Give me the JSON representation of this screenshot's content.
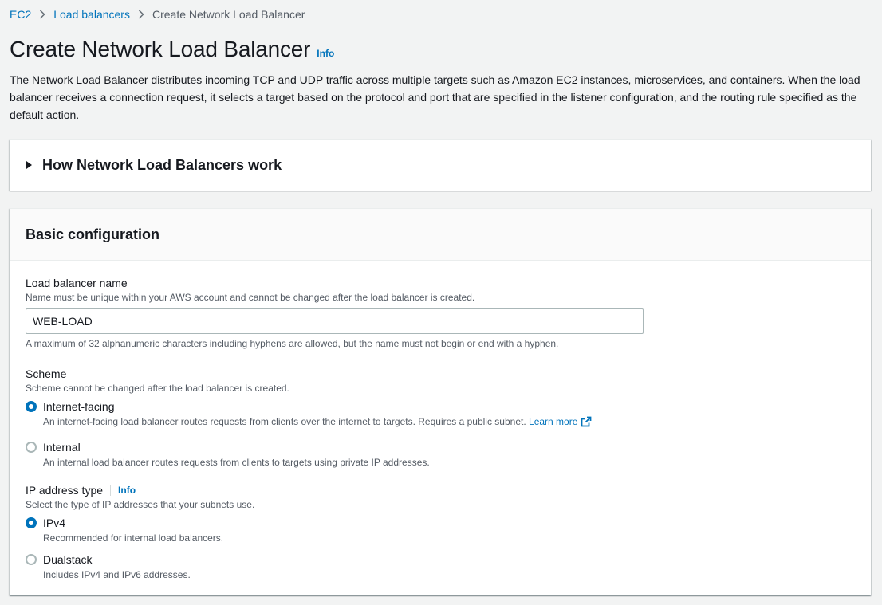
{
  "breadcrumb": {
    "items": [
      "EC2",
      "Load balancers"
    ],
    "current": "Create Network Load Balancer"
  },
  "page": {
    "title": "Create Network Load Balancer",
    "info": "Info",
    "description": "The Network Load Balancer distributes incoming TCP and UDP traffic across multiple targets such as Amazon EC2 instances, microservices, and containers. When the load balancer receives a connection request, it selects a target based on the protocol and port that are specified in the listener configuration, and the routing rule specified as the default action."
  },
  "how_it_works": {
    "title": "How Network Load Balancers work"
  },
  "basic_config": {
    "title": "Basic configuration",
    "name_field": {
      "label": "Load balancer name",
      "description": "Name must be unique within your AWS account and cannot be changed after the load balancer is created.",
      "value": "WEB-LOAD",
      "constraint": "A maximum of 32 alphanumeric characters including hyphens are allowed, but the name must not begin or end with a hyphen."
    },
    "scheme": {
      "label": "Scheme",
      "description": "Scheme cannot be changed after the load balancer is created.",
      "options": [
        {
          "label": "Internet-facing",
          "description": "An internet-facing load balancer routes requests from clients over the internet to targets. Requires a public subnet.",
          "link": "Learn more",
          "checked": true
        },
        {
          "label": "Internal",
          "description": "An internal load balancer routes requests from clients to targets using private IP addresses.",
          "checked": false
        }
      ]
    },
    "ip_type": {
      "label": "IP address type",
      "info": "Info",
      "description": "Select the type of IP addresses that your subnets use.",
      "options": [
        {
          "label": "IPv4",
          "description": "Recommended for internal load balancers.",
          "checked": true
        },
        {
          "label": "Dualstack",
          "description": "Includes IPv4 and IPv6 addresses.",
          "checked": false
        }
      ]
    }
  },
  "colors": {
    "link": "#0073bb",
    "background": "#f2f3f3",
    "text": "#16191f",
    "muted": "#545b64"
  }
}
